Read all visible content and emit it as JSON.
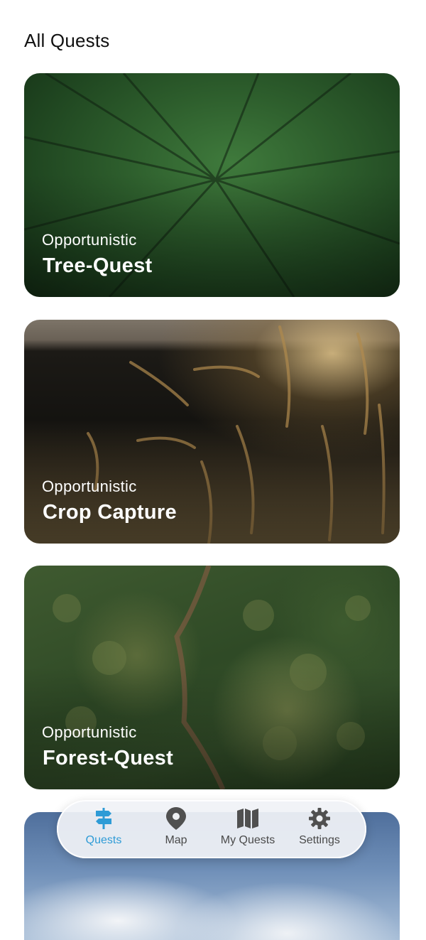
{
  "page": {
    "title": "All Quests"
  },
  "quests": [
    {
      "category": "Opportunistic",
      "title": "Tree-Quest"
    },
    {
      "category": "Opportunistic",
      "title": "Crop Capture"
    },
    {
      "category": "Opportunistic",
      "title": "Forest-Quest"
    },
    {
      "category": "",
      "title": ""
    }
  ],
  "nav": {
    "items": [
      {
        "label": "Quests",
        "icon": "signpost-icon",
        "active": true
      },
      {
        "label": "Map",
        "icon": "map-pin-icon",
        "active": false
      },
      {
        "label": "My Quests",
        "icon": "map-icon",
        "active": false
      },
      {
        "label": "Settings",
        "icon": "gear-icon",
        "active": false
      }
    ],
    "active_color": "#2E9BD6",
    "inactive_color": "#4A4A4A"
  }
}
